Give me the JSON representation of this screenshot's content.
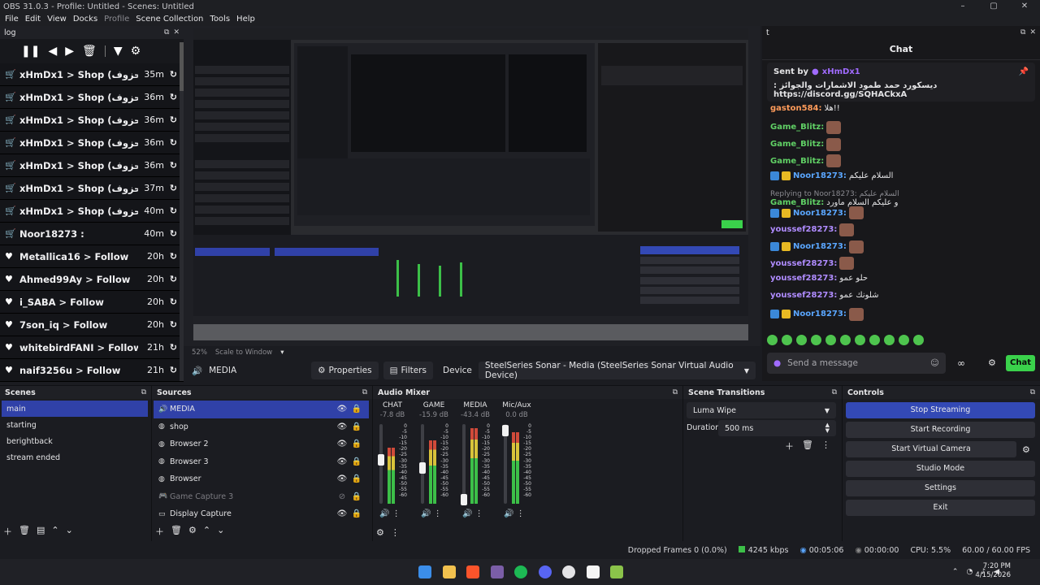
{
  "window": {
    "title": "OBS 31.0.3 - Profile: Untitled - Scenes: Untitled",
    "min": "–",
    "max": "▢",
    "close": "✕"
  },
  "menu": [
    "File",
    "Edit",
    "View",
    "Docks",
    "Profile",
    "Scene Collection",
    "Tools",
    "Help"
  ],
  "log_dock": {
    "title": "log",
    "events": [
      {
        "icon": "cart-icon",
        "text": "xHmDx1 > Shop (حزوف)",
        "time": "35m",
        "action": "replay-icon"
      },
      {
        "icon": "cart-icon",
        "text": "xHmDx1 > Shop (حزوف)",
        "time": "36m",
        "action": "replay-icon"
      },
      {
        "icon": "cart-icon",
        "text": "xHmDx1 > Shop (حزوف)",
        "time": "36m",
        "action": "replay-icon"
      },
      {
        "icon": "cart-icon",
        "text": "xHmDx1 > Shop (حزوف)",
        "time": "36m",
        "action": "replay-icon"
      },
      {
        "icon": "cart-icon",
        "text": "xHmDx1 > Shop (حزوف)",
        "time": "36m",
        "action": "replay-icon"
      },
      {
        "icon": "cart-icon",
        "text": "xHmDx1 > Shop (حزوف)",
        "time": "37m",
        "action": "replay-icon"
      },
      {
        "icon": "cart-icon",
        "text": "xHmDx1 > Shop (حزوف)",
        "time": "40m",
        "action": "replay-icon"
      },
      {
        "icon": "cart-icon",
        "text": "Noor18273 :",
        "time": "40m",
        "action": "replay-icon"
      },
      {
        "icon": "heart-icon",
        "text": "Metallica16 > Follow",
        "time": "20h",
        "action": "replay-icon"
      },
      {
        "icon": "heart-icon",
        "text": "Ahmed99Ay > Follow",
        "time": "20h",
        "action": "replay-icon"
      },
      {
        "icon": "heart-icon",
        "text": "i_SABA > Follow",
        "time": "20h",
        "action": "replay-icon"
      },
      {
        "icon": "heart-icon",
        "text": "7son_iq > Follow",
        "time": "20h",
        "action": "replay-icon"
      },
      {
        "icon": "heart-icon",
        "text": "whitebirdFANI > Follow",
        "time": "21h",
        "action": "replay-icon"
      },
      {
        "icon": "heart-icon",
        "text": "naif3256u > Follow",
        "time": "21h",
        "action": "replay-icon"
      }
    ]
  },
  "zoom": {
    "percent": "52%",
    "mode": "Scale to Window"
  },
  "context": {
    "source": "MEDIA",
    "properties": "Properties",
    "filters": "Filters",
    "device_label": "Device",
    "device_value": "SteelSeries Sonar - Media (SteelSeries Sonar Virtual Audio Device)"
  },
  "chat": {
    "dock_title": "t",
    "header": "Chat",
    "pinned": {
      "label": "Sent by",
      "user": "xHmDx1",
      "message": "ديسكورد حمد طمود الاشمارات والجوائز : https://discord.gg/SQHACkxA"
    },
    "messages": [
      {
        "user": "gaston584:",
        "text": "هلا!!",
        "color": "#ff9b5a",
        "badges": false,
        "emote": false,
        "reply": ""
      },
      {
        "user": "Game_Blitz:",
        "text": "",
        "color": "#60d065",
        "badges": false,
        "emote": true,
        "reply": ""
      },
      {
        "user": "Game_Blitz:",
        "text": "",
        "color": "#60d065",
        "badges": false,
        "emote": true,
        "reply": ""
      },
      {
        "user": "Game_Blitz:",
        "text": "",
        "color": "#60d065",
        "badges": false,
        "emote": true,
        "reply": ""
      },
      {
        "user": "Noor18273:",
        "text": "السلام عليكم",
        "color": "#5aa6ff",
        "badges": true,
        "emote": false,
        "reply": ""
      },
      {
        "user": "Game_Blitz:",
        "text": "و عليكم السلام ماورد",
        "color": "#60d065",
        "badges": false,
        "emote": false,
        "reply": "Replying to Noor18273: السلام عليكم"
      },
      {
        "user": "Noor18273:",
        "text": "",
        "color": "#5aa6ff",
        "badges": true,
        "emote": true,
        "reply": ""
      },
      {
        "user": "youssef28273:",
        "text": "",
        "color": "#b08cff",
        "badges": false,
        "emote": true,
        "reply": ""
      },
      {
        "user": "Noor18273:",
        "text": "",
        "color": "#5aa6ff",
        "badges": true,
        "emote": true,
        "reply": ""
      },
      {
        "user": "youssef28273:",
        "text": "",
        "color": "#b08cff",
        "badges": false,
        "emote": true,
        "reply": ""
      },
      {
        "user": "youssef28273:",
        "text": "حلو عمو",
        "color": "#b08cff",
        "badges": false,
        "emote": false,
        "reply": ""
      },
      {
        "user": "youssef28273:",
        "text": "شلونك عمو",
        "color": "#b08cff",
        "badges": false,
        "emote": false,
        "reply": ""
      },
      {
        "user": "Noor18273:",
        "text": "",
        "color": "#5aa6ff",
        "badges": true,
        "emote": true,
        "reply": ""
      }
    ],
    "input_placeholder": "Send a message",
    "send_label": "Chat"
  },
  "scenes": {
    "title": "Scenes",
    "items": [
      "main",
      "starting",
      "berightback",
      "stream ended"
    ],
    "selected": 0
  },
  "sources": {
    "title": "Sources",
    "items": [
      {
        "name": "MEDIA",
        "icon": "speaker-icon",
        "visible": true,
        "locked": true,
        "dim": false
      },
      {
        "name": "shop",
        "icon": "globe-icon",
        "visible": true,
        "locked": false,
        "dim": false
      },
      {
        "name": "Browser 2",
        "icon": "globe-icon",
        "visible": true,
        "locked": true,
        "dim": false
      },
      {
        "name": "Browser 3",
        "icon": "globe-icon",
        "visible": true,
        "locked": true,
        "dim": false
      },
      {
        "name": "Browser",
        "icon": "globe-icon",
        "visible": true,
        "locked": true,
        "dim": false
      },
      {
        "name": "Game Capture 3",
        "icon": "gamepad-icon",
        "visible": false,
        "locked": false,
        "dim": true
      },
      {
        "name": "Display Capture",
        "icon": "monitor-icon",
        "visible": true,
        "locked": false,
        "dim": false
      }
    ]
  },
  "mixer": {
    "title": "Audio Mixer",
    "ticks": [
      "0",
      "-5",
      "-10",
      "-15",
      "-20",
      "-25",
      "-30",
      "-35",
      "-40",
      "-45",
      "-50",
      "-55",
      "-60"
    ],
    "channels": [
      {
        "name": "CHAT",
        "db": "-7.8 dB",
        "level": 0.7,
        "fader": 0.45
      },
      {
        "name": "GAME",
        "db": "-15.9 dB",
        "level": 0.8,
        "fader": 0.55
      },
      {
        "name": "MEDIA",
        "db": "-43.4 dB",
        "level": 0.95,
        "fader": 0.95
      },
      {
        "name": "Mic/Aux",
        "db": "0.0 dB",
        "level": 0.9,
        "fader": 0.08
      }
    ]
  },
  "transitions": {
    "title": "Scene Transitions",
    "selected": "Luma Wipe",
    "duration_label": "Duration",
    "duration_value": "500 ms"
  },
  "controls": {
    "title": "Controls",
    "buttons": [
      "Stop Streaming",
      "Start Recording",
      "Start Virtual Camera",
      "Studio Mode",
      "Settings",
      "Exit"
    ]
  },
  "status": {
    "dropped": "Dropped Frames 0 (0.0%)",
    "bitrate": "4245 kbps",
    "live_time": "00:05:06",
    "rec_time": "00:00:00",
    "cpu": "CPU: 5.5%",
    "fps": "60.00 / 60.00 FPS"
  },
  "taskbar": {
    "time": "7:20 PM",
    "date": "4/15/2026",
    "colors": [
      "#3b8eea",
      "#f2c14e",
      "#fb542b",
      "#7b5ea7",
      "#1db954",
      "#5865f2",
      "#e4e4e6",
      "#f5f5f5",
      "#8bc34a"
    ]
  }
}
